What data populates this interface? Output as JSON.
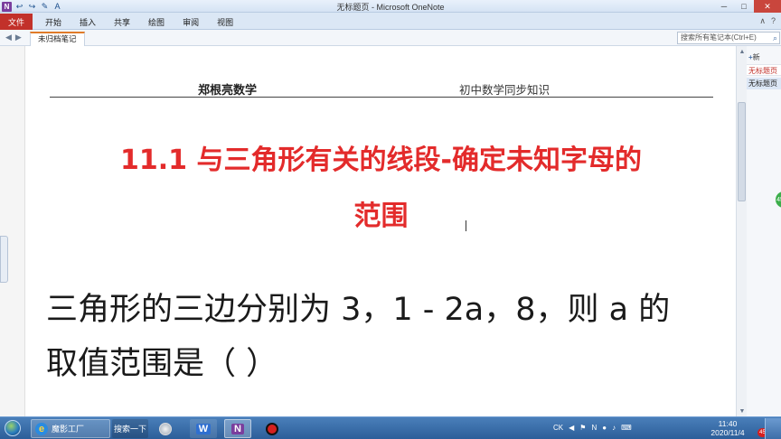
{
  "window": {
    "title": "无标题页 - Microsoft OneNote",
    "app_icon": "N",
    "controls": [
      "─",
      "□",
      "✕"
    ]
  },
  "quick_access": [
    "↩",
    "↪",
    "✎",
    "A"
  ],
  "ribbon": {
    "file_tab": "文件",
    "tabs": [
      "开始",
      "插入",
      "共享",
      "绘图",
      "审阅",
      "视图"
    ],
    "right_controls": [
      "∧",
      "?"
    ]
  },
  "navbar": {
    "section_tab": "未归档笔记",
    "search_placeholder": "搜索所有笔记本(Ctrl+E)"
  },
  "pages_panel": {
    "new_page": "新",
    "items": [
      "无标题页",
      "无标题页"
    ],
    "handle_badge": "45"
  },
  "document": {
    "header_left": "郑根亮数学",
    "header_right": "初中数学同步知识",
    "title_line1": "11.1 与三角形有关的线段-确定未知字母的",
    "title_line2": "范围",
    "question_line1": "三角形的三边分别为 3，1 - 2a，8，则 a 的",
    "question_line2": "取值范围是（        ）"
  },
  "taskbar": {
    "ie_label": "魔影工厂",
    "search_label": "搜索一下",
    "wps_label": "W",
    "onenote_label": "N",
    "tray": [
      "CK",
      "◀",
      "⚑",
      "N",
      "●",
      "♪",
      "⌨"
    ],
    "time": "11:40",
    "date": "2020/11/4",
    "notif_count": "45"
  },
  "colors": {
    "title_red": "#e32b2b",
    "file_tab": "#c2312a",
    "section_accent": "#e07b28",
    "taskbar": "#2c5e99",
    "onenote_purple": "#7a3e9d"
  }
}
